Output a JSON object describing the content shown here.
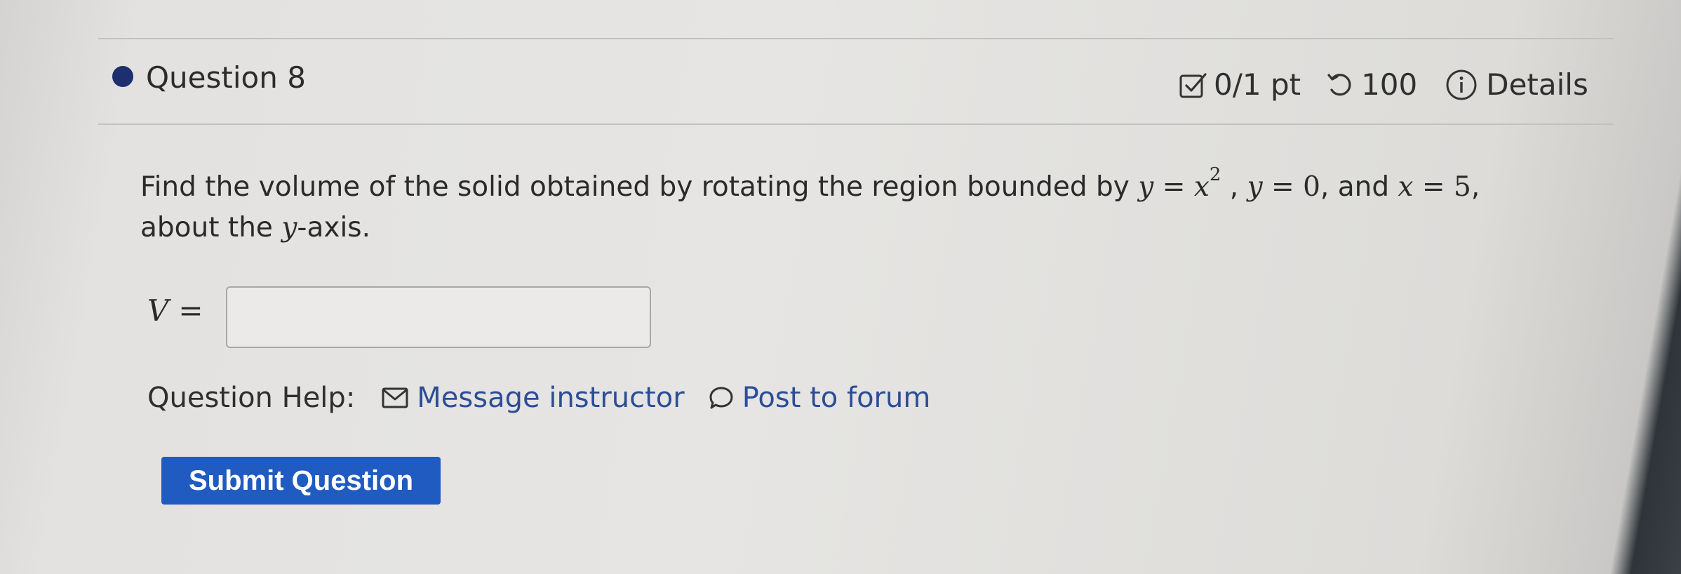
{
  "question": {
    "title": "Question 8",
    "points": "0/1 pt",
    "retries": "100",
    "details_label": "Details"
  },
  "prompt": {
    "lead": "Find the volume of the solid obtained by rotating the region bounded by",
    "eq1_var": "y",
    "eq1_rhs": "x",
    "eq1_exp": "2",
    "eq2_var": "y",
    "eq2_rhs": "0",
    "joiner": "and",
    "eq3_var": "x",
    "eq3_rhs": "5",
    "line2_start": "about the",
    "axis_var": "y",
    "line2_end": "-axis."
  },
  "answer": {
    "label": "V",
    "value": ""
  },
  "help": {
    "label": "Question Help:",
    "message_label": "Message instructor",
    "forum_label": "Post to forum"
  },
  "submit_label": "Submit Question",
  "icons": {
    "bullet": "filled-circle-icon",
    "points": "checkbox-edit-icon",
    "retries": "undo-arrow-icon",
    "details": "info-circle-icon",
    "message": "envelope-icon",
    "forum": "speech-bubble-icon"
  },
  "colors": {
    "bullet": "#1d2f6e",
    "link": "#2d4d96",
    "submit_bg": "#1f5bc0",
    "submit_text": "#ffffff"
  }
}
